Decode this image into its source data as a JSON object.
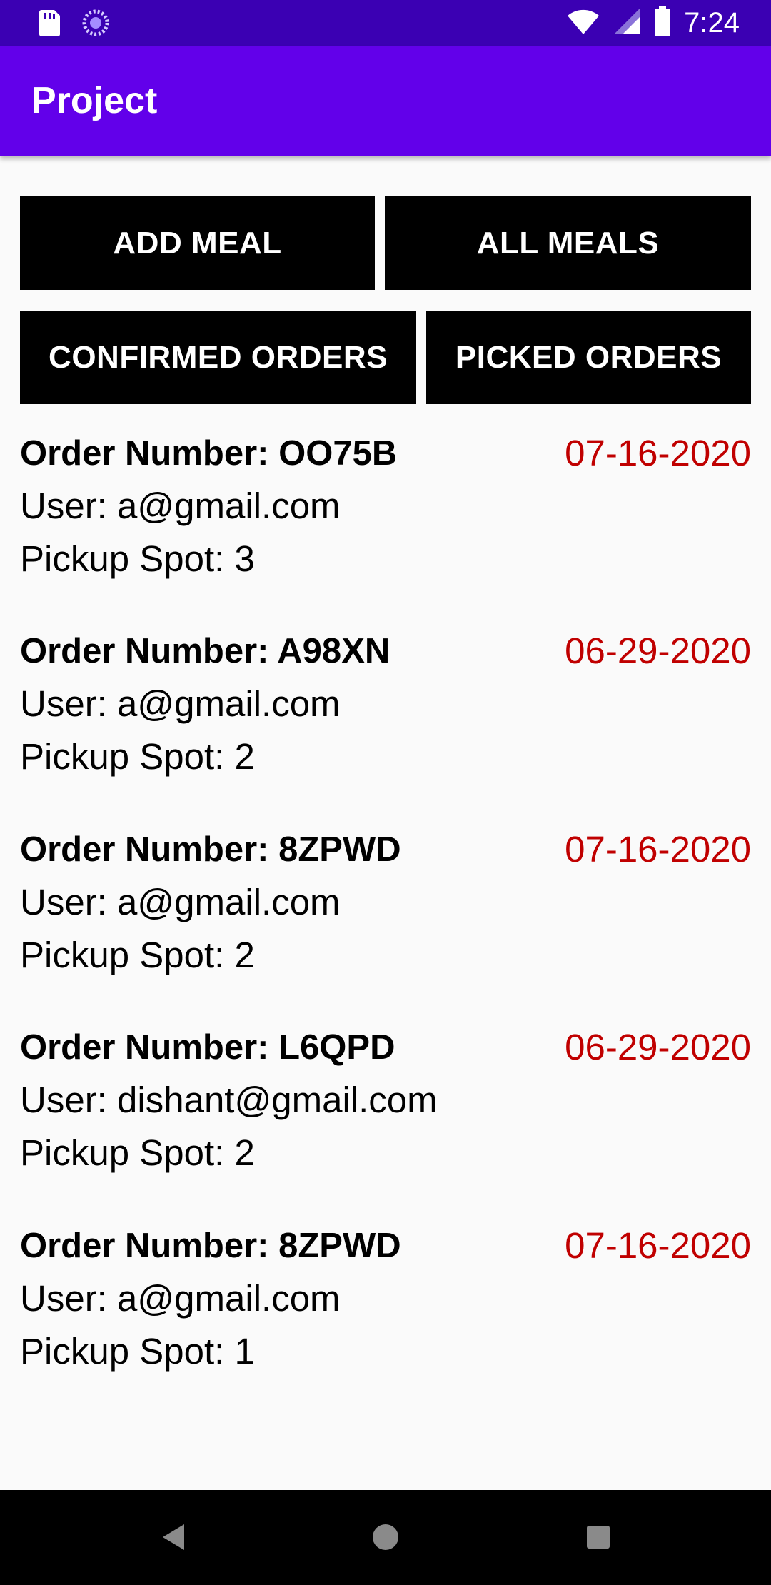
{
  "status_bar": {
    "time": "7:24",
    "icons": [
      "sd-card-icon",
      "sync-icon",
      "wifi-icon",
      "signal-icon",
      "battery-icon"
    ]
  },
  "app_bar": {
    "title": "Project"
  },
  "buttons": {
    "add_meal": "ADD MEAL",
    "all_meals": "ALL MEALS",
    "confirmed_orders": "CONFIRMED ORDERS",
    "picked_orders": "PICKED ORDERS"
  },
  "orders": [
    {
      "number": "Order Number: OO75B",
      "date": "07-16-2020",
      "user": "User: a@gmail.com",
      "spot": "Pickup Spot: 3"
    },
    {
      "number": "Order Number: A98XN",
      "date": "06-29-2020",
      "user": "User: a@gmail.com",
      "spot": "Pickup Spot: 2"
    },
    {
      "number": "Order Number: 8ZPWD",
      "date": "07-16-2020",
      "user": "User: a@gmail.com",
      "spot": "Pickup Spot: 2"
    },
    {
      "number": "Order Number: L6QPD",
      "date": "06-29-2020",
      "user": "User: dishant@gmail.com",
      "spot": "Pickup Spot: 2"
    },
    {
      "number": "Order Number: 8ZPWD",
      "date": "07-16-2020",
      "user": "User: a@gmail.com",
      "spot": "Pickup Spot: 1"
    }
  ],
  "colors": {
    "status_bar": "#3b00b3",
    "app_bar": "#6200ea",
    "date_text": "#c00000",
    "button_bg": "#000000"
  },
  "nav_bar": {
    "icons": [
      "back-icon",
      "home-icon",
      "recents-icon"
    ]
  }
}
